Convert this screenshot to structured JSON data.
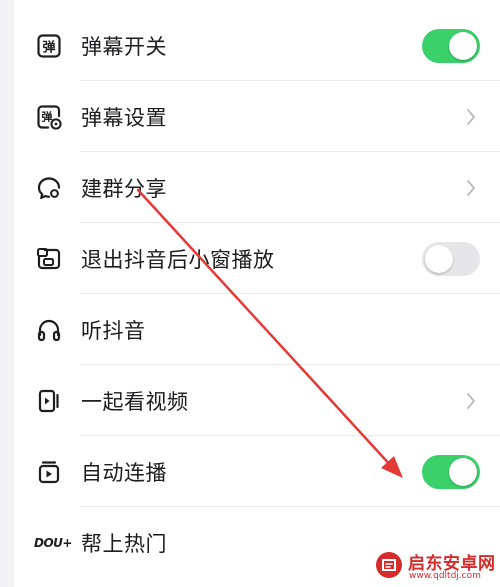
{
  "settings": {
    "items": [
      {
        "label": "弹幕开关",
        "control": "toggle",
        "state": "on"
      },
      {
        "label": "弹幕设置",
        "control": "chevron"
      },
      {
        "label": "建群分享",
        "control": "chevron"
      },
      {
        "label": "退出抖音后小窗播放",
        "control": "toggle",
        "state": "off"
      },
      {
        "label": "听抖音",
        "control": "none"
      },
      {
        "label": "一起看视频",
        "control": "chevron"
      },
      {
        "label": "自动连播",
        "control": "toggle",
        "state": "on"
      },
      {
        "label": "帮上热门",
        "control": "none",
        "logo_text": "DOU+"
      }
    ]
  },
  "colors": {
    "toggle_on": "#3ad06a",
    "toggle_off": "#e6e6e9",
    "annotation_arrow": "#e53935",
    "watermark": "#d52b2b"
  },
  "icons": {
    "danmaku_toggle": "danmaku-box-icon",
    "danmaku_settings": "danmaku-settings-icon",
    "group_share": "chat-bubble-icon",
    "pip": "picture-in-picture-icon",
    "listen": "headphones-icon",
    "watch_together": "shared-video-icon",
    "autoplay": "autoplay-icon"
  },
  "watermark": {
    "name": "启东安卓网",
    "url": "www.qdltdj.com"
  }
}
